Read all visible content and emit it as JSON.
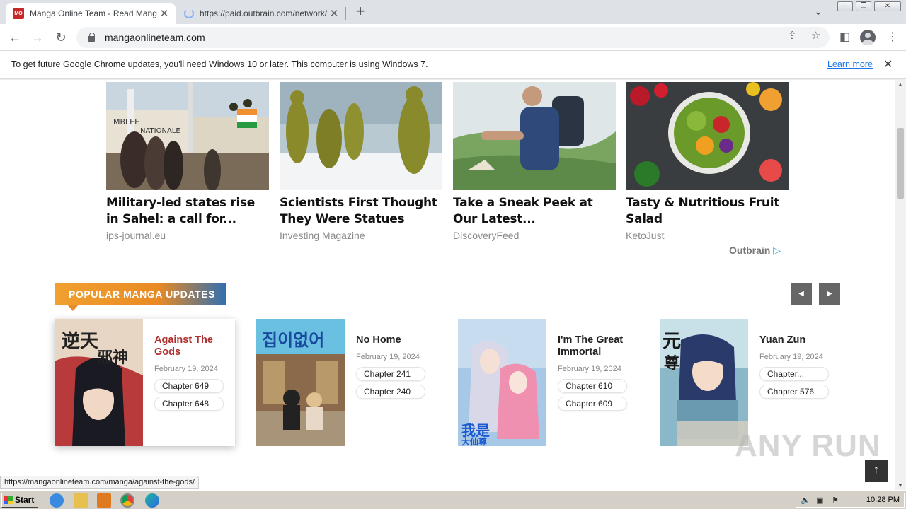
{
  "browser": {
    "tabs": [
      {
        "title": "Manga Online Team - Read Manga Online",
        "favicon": "manga-favicon",
        "active": true
      },
      {
        "title": "https://paid.outbrain.com/network/redir",
        "favicon": "loading-spinner",
        "active": false
      }
    ],
    "address": "mangaonlineteam.com",
    "infobar": {
      "message": "To get future Google Chrome updates, you'll need Windows 10 or later. This computer is using Windows 7.",
      "link": "Learn more"
    }
  },
  "outbrain": {
    "cards": [
      {
        "title": "Military-led states rise in Sahel: a call for...",
        "source": "ips-journal.eu"
      },
      {
        "title": "Scientists First Thought They Were Statues",
        "source": "Investing Magazine"
      },
      {
        "title": "Take a Sneak Peek at Our Latest...",
        "source": "DiscoveryFeed"
      },
      {
        "title": "Tasty & Nutritious Fruit Salad",
        "source": "KetoJust"
      }
    ],
    "logo": "Outbrain"
  },
  "section": {
    "heading": "POPULAR MANGA UPDATES",
    "prev": "◀",
    "next": "▶"
  },
  "manga": [
    {
      "title": "Against The Gods",
      "date": "February 19, 2024",
      "chapters": [
        "Chapter 649",
        "Chapter 648"
      ]
    },
    {
      "title": "No Home",
      "date": "February 19, 2024",
      "chapters": [
        "Chapter 241",
        "Chapter 240"
      ]
    },
    {
      "title": "I'm The Great Immortal",
      "date": "February 19, 2024",
      "chapters": [
        "Chapter 610",
        "Chapter 609"
      ]
    },
    {
      "title": "Yuan Zun",
      "date": "February 19, 2024",
      "chapters": [
        "Chapter...",
        "Chapter 576"
      ]
    }
  ],
  "status_url": "https://mangaonlineteam.com/manga/against-the-gods/",
  "watermark": "ANY RUN",
  "taskbar": {
    "start": "Start",
    "clock": "10:28 PM"
  },
  "colors": {
    "accent_orange": "#ea8a24",
    "accent_blue": "#2f6fb0",
    "link_blue": "#1a73e8"
  }
}
